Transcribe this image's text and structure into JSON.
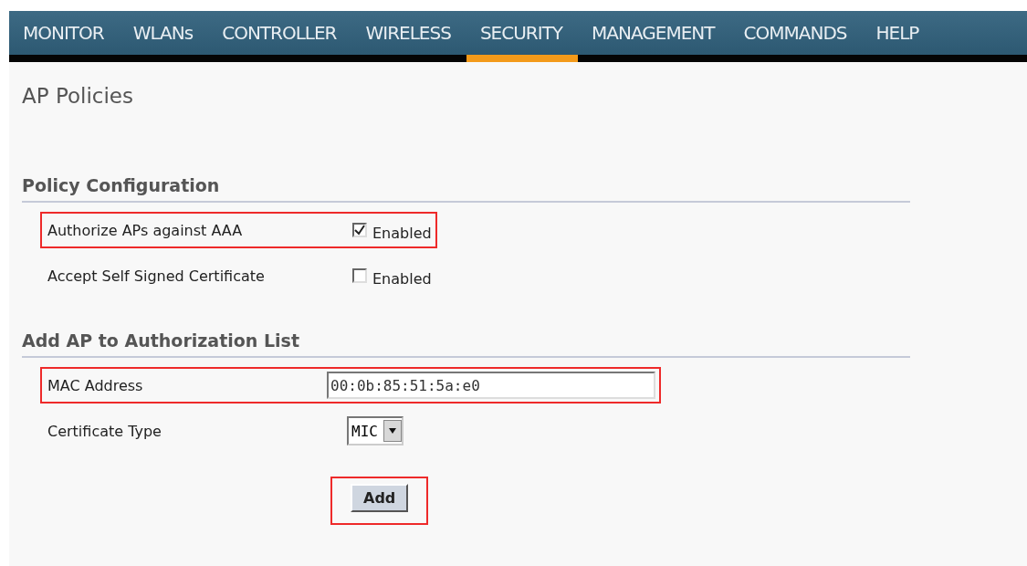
{
  "nav": [
    {
      "label": "MONITOR",
      "selected": false
    },
    {
      "label": "WLANs",
      "selected": false
    },
    {
      "label": "CONTROLLER",
      "selected": false
    },
    {
      "label": "WIRELESS",
      "selected": false
    },
    {
      "label": "SECURITY",
      "selected": true
    },
    {
      "label": "MANAGEMENT",
      "selected": false
    },
    {
      "label": "COMMANDS",
      "selected": false
    },
    {
      "label": "HELP",
      "selected": false
    }
  ],
  "page_title": "AP Policies",
  "sections": [
    {
      "title": "Policy Configuration",
      "rows": [
        {
          "kind": "checkbox",
          "label": "Authorize APs against AAA",
          "checked": true,
          "option": "Enabled",
          "highlighted": true
        },
        {
          "kind": "checkbox",
          "label": "Accept Self Signed Certificate",
          "checked": false,
          "option": "Enabled",
          "highlighted": false
        }
      ]
    },
    {
      "title": "Add AP to Authorization List",
      "rows": [
        {
          "kind": "text",
          "label": "MAC Address",
          "value": "00:0b:85:51:5a:e0",
          "highlighted": true
        },
        {
          "kind": "select",
          "label": "Certificate Type",
          "value": "MIC",
          "highlighted": false
        }
      ]
    }
  ],
  "add_button": {
    "label": "Add",
    "highlighted": true
  }
}
